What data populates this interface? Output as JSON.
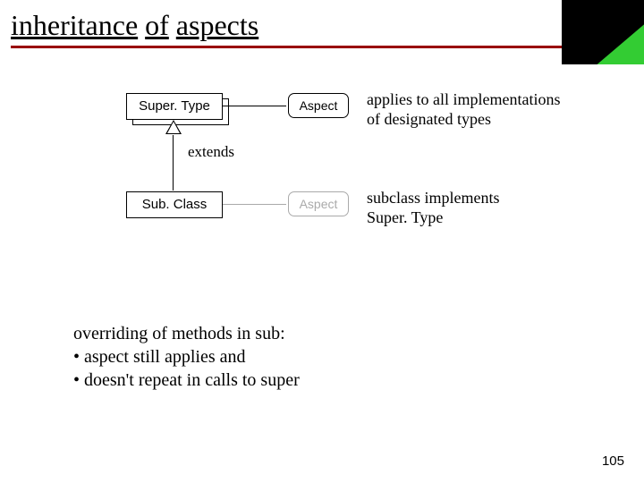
{
  "title": {
    "w1": "inheritance",
    "w2": "of",
    "w3": "aspects"
  },
  "boxes": {
    "super": "Super. Type",
    "sub": "Sub. Class",
    "aspect": "Aspect"
  },
  "extends_label": "extends",
  "captions": {
    "line1a": "applies to all implementations",
    "line1b": "of designated types",
    "line2a": "subclass implements",
    "line2b": "Super. Type"
  },
  "para": {
    "l1": "overriding of methods in sub:",
    "l2": "• aspect still applies and",
    "l3": "• doesn't repeat in calls to super"
  },
  "page": "105",
  "colors": {
    "rule": "#990000",
    "corner_accent": "#33cc33"
  }
}
